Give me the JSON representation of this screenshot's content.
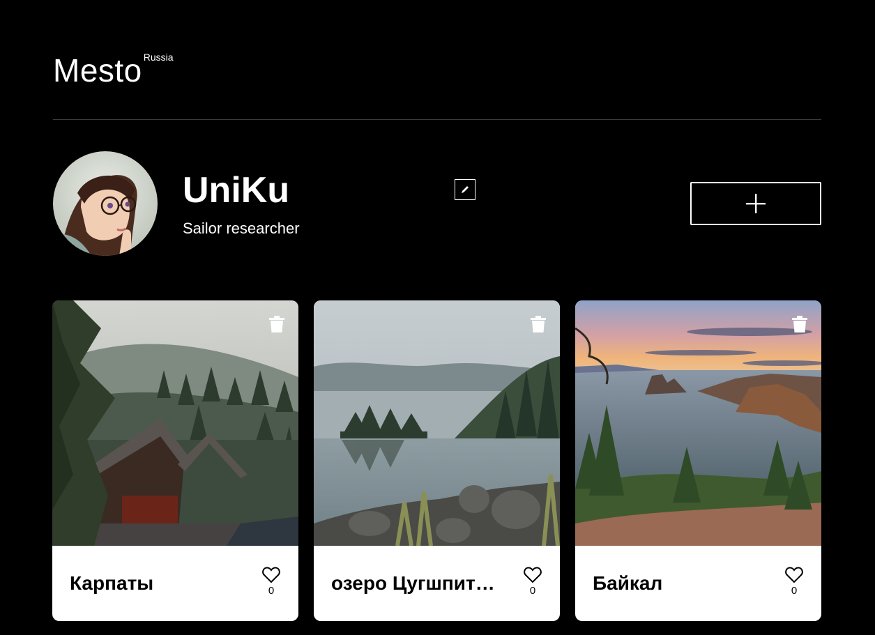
{
  "header": {
    "logo": "Mesto",
    "logo_sup": "Russia"
  },
  "profile": {
    "name": "UniKu",
    "about": "Sailor researcher"
  },
  "cards": [
    {
      "title": "Карпаты",
      "likes": "0"
    },
    {
      "title": "озеро Цугшпит…",
      "likes": "0"
    },
    {
      "title": "Байкал",
      "likes": "0"
    }
  ],
  "icons": {
    "edit": "pencil-icon",
    "add": "plus-icon",
    "delete": "trash-icon",
    "like": "heart-icon"
  },
  "colors": {
    "background": "#000000",
    "text": "#ffffff",
    "card_background": "#ffffff",
    "card_text": "#000000"
  }
}
